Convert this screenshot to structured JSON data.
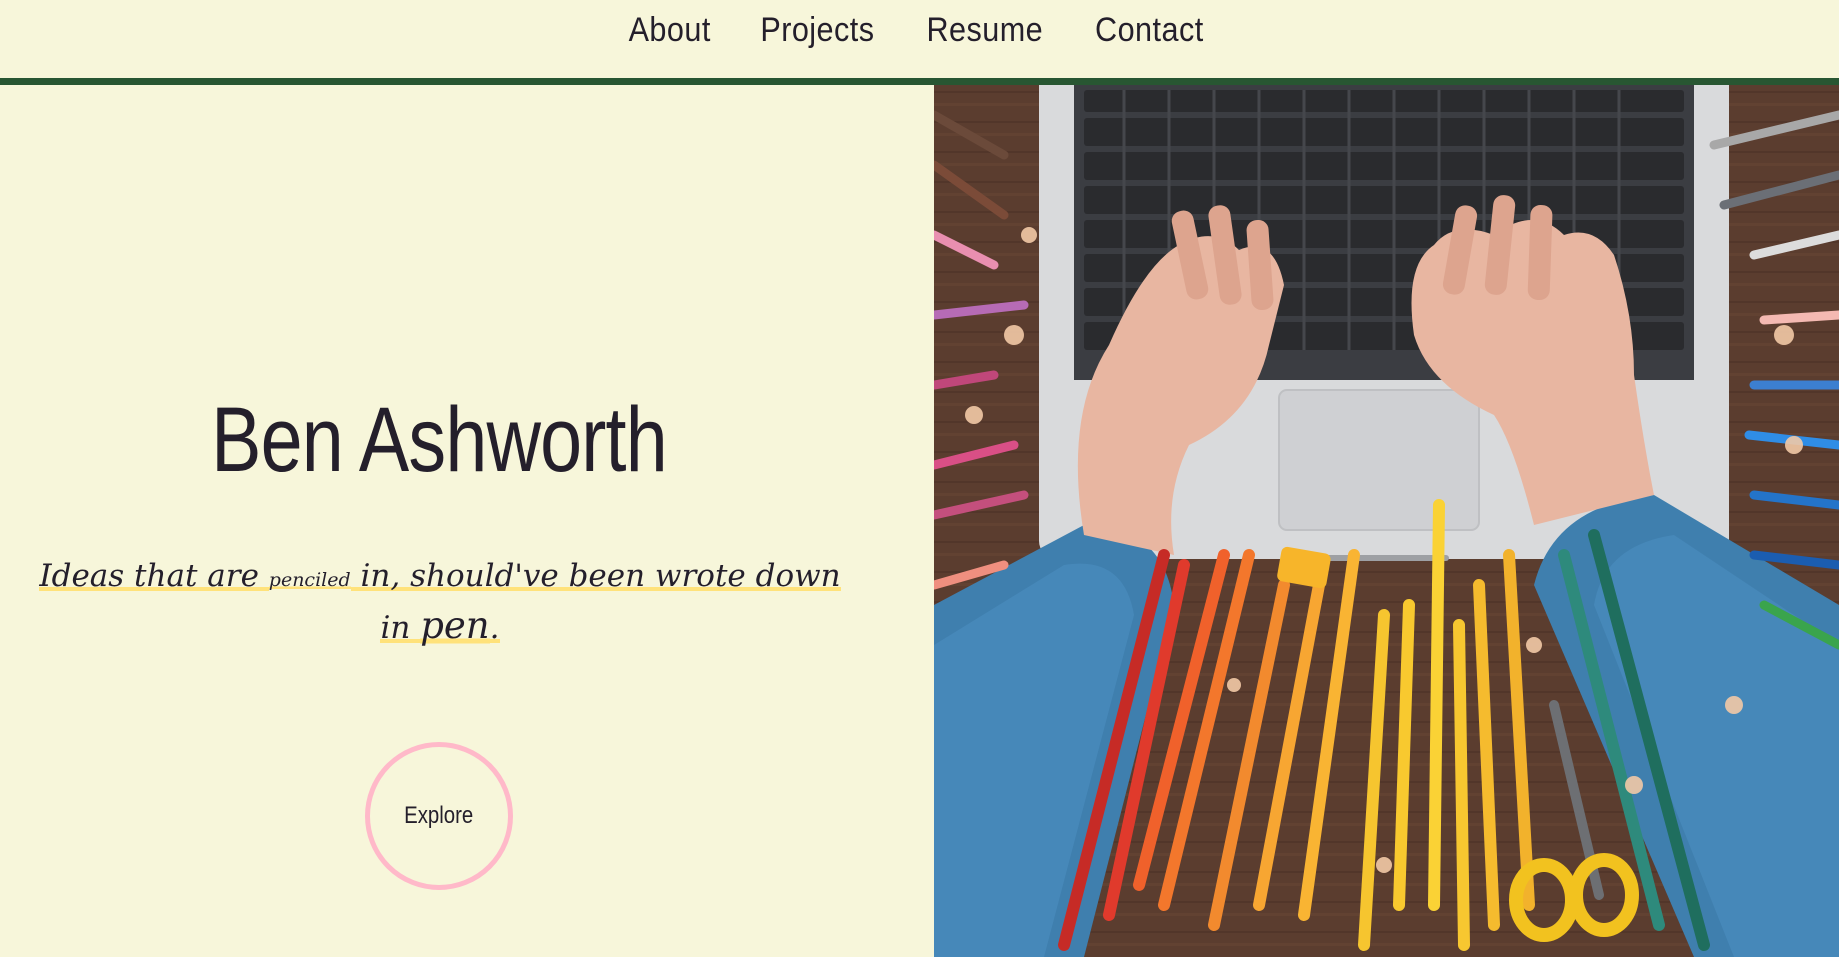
{
  "nav": {
    "items": [
      {
        "label": "About"
      },
      {
        "label": "Projects"
      },
      {
        "label": "Resume"
      },
      {
        "label": "Contact"
      }
    ]
  },
  "hero": {
    "name": "Ben Ashworth",
    "tagline": {
      "part1": "Ideas that are ",
      "small_word": "penciled",
      "part2": " in, should've been wrote down in ",
      "big_word": "pen",
      "part3": "."
    },
    "explore_label": "Explore"
  },
  "colors": {
    "background": "#f7f6da",
    "nav_rule": "#285632",
    "text": "#241f2b",
    "button_ring": "#ffb9c9",
    "highlight": "#ffe27a"
  },
  "image": {
    "subject": "hands-typing-on-laptop-with-colored-pencils"
  }
}
